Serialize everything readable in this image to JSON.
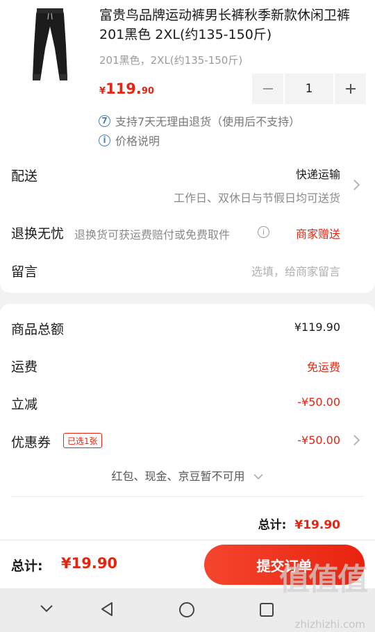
{
  "product": {
    "title": "富贵鸟品牌运动裤男长裤秋季新款休闲卫裤 201黑色 2XL(约135-150斤)",
    "spec": "201黑色，2XL(约135-150斤)",
    "price_symbol": "¥",
    "price_int": "119.",
    "price_dec": "90",
    "quantity": "1",
    "minus_icon": "minus-icon",
    "plus_icon": "plus-icon",
    "service_return": "支持7天无理由退货（使用后不支持）",
    "service_return_badge": "7",
    "service_price": "价格说明",
    "service_price_badge": "i"
  },
  "delivery": {
    "label": "配送",
    "method": "快递运输",
    "detail": "工作日、双休日与节假日均可送货"
  },
  "returns": {
    "label": "退换无忧",
    "desc": "退换货可获运费赔付或免费取件",
    "info_badge": "i",
    "gift": "商家赠送"
  },
  "message": {
    "label": "留言",
    "placeholder": "选填，给商家留言"
  },
  "summary": {
    "goods_label": "商品总额",
    "goods_value": "¥119.90",
    "freight_label": "运费",
    "freight_value": "免运费",
    "discount_label": "立减",
    "discount_value": "-¥50.00",
    "coupon_label": "优惠券",
    "coupon_tag": "已选1张",
    "coupon_value": "-¥50.00",
    "unavailable": "红包、现金、京豆暂不可用",
    "total_label": "总计:",
    "total_value": "¥19.90"
  },
  "bottom_bar": {
    "total_label": "总计:",
    "total_value": "¥19.90",
    "submit": "提交订单"
  },
  "watermark": {
    "text": "值值值",
    "site": "zhizhizhi.com"
  },
  "colors": {
    "accent": "#e8230f",
    "link_blue": "#4a7fc1"
  }
}
